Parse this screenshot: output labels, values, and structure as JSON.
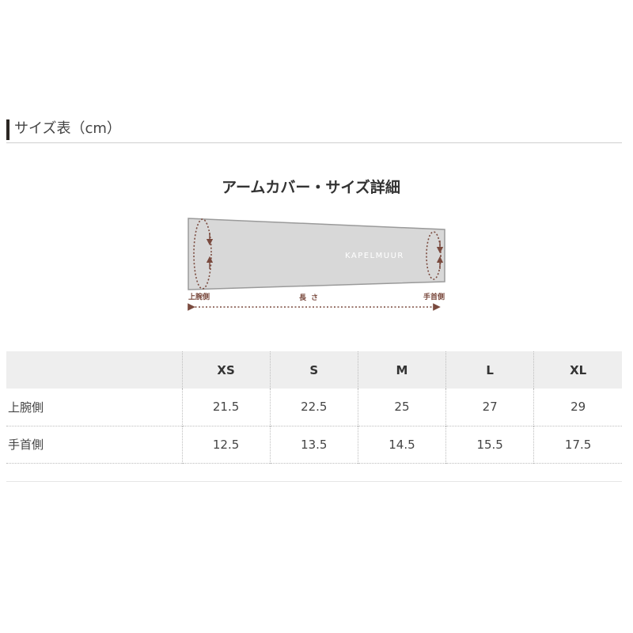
{
  "header": {
    "title": "サイズ表（cm）"
  },
  "diagram": {
    "title": "アームカバー・サイズ詳細",
    "brand": "KAPELMUUR",
    "labels": {
      "upper_arm": "上腕側",
      "length": "長さ",
      "wrist": "手首側"
    },
    "colors": {
      "sleeve": "#d8d8d8",
      "outline": "#9a9a9a",
      "arrow": "#7a4a3e"
    }
  },
  "table": {
    "corner": "",
    "headers": [
      "XS",
      "S",
      "M",
      "L",
      "XL"
    ],
    "rows": [
      {
        "label": "上腕側",
        "values": [
          "21.5",
          "22.5",
          "25",
          "27",
          "29"
        ]
      },
      {
        "label": "手首側",
        "values": [
          "12.5",
          "13.5",
          "14.5",
          "15.5",
          "17.5"
        ]
      }
    ]
  }
}
